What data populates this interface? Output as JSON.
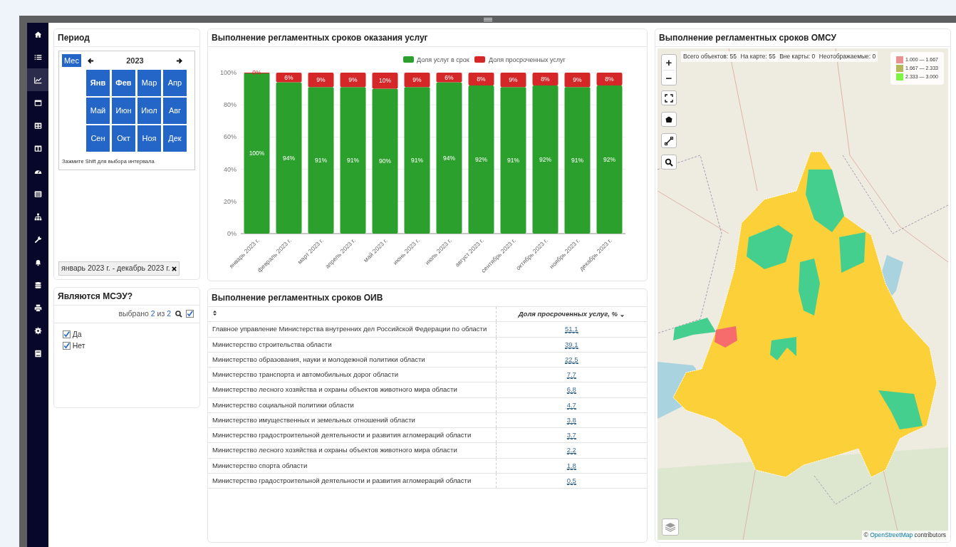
{
  "sidebar": {
    "items": [
      {
        "kind": "home",
        "selected": false
      },
      {
        "kind": "list",
        "selected": false
      },
      {
        "kind": "chart",
        "selected": true
      },
      {
        "kind": "window",
        "selected": false
      },
      {
        "kind": "table",
        "selected": false
      },
      {
        "kind": "columns",
        "selected": false
      },
      {
        "kind": "gauge",
        "selected": false
      },
      {
        "kind": "listbox",
        "selected": false
      },
      {
        "kind": "hierarchy",
        "selected": false
      },
      {
        "kind": "wrench",
        "selected": false
      },
      {
        "kind": "bell",
        "selected": false
      },
      {
        "kind": "database",
        "selected": false
      },
      {
        "kind": "printer",
        "selected": false
      },
      {
        "kind": "gear",
        "selected": false
      },
      {
        "kind": "book",
        "selected": false
      }
    ]
  },
  "period_panel": {
    "title": "Период",
    "mode_button": "Мес",
    "year": "2023",
    "months": [
      {
        "label": "Янв",
        "selected": true,
        "bold": true
      },
      {
        "label": "Фев",
        "selected": true,
        "bold": true
      },
      {
        "label": "Мар",
        "selected": true,
        "bold": false
      },
      {
        "label": "Апр",
        "selected": true,
        "bold": false
      },
      {
        "label": "Май",
        "selected": true,
        "bold": false
      },
      {
        "label": "Июн",
        "selected": true,
        "bold": false
      },
      {
        "label": "Июл",
        "selected": true,
        "bold": false
      },
      {
        "label": "Авг",
        "selected": true,
        "bold": false
      },
      {
        "label": "Сен",
        "selected": true,
        "bold": false
      },
      {
        "label": "Окт",
        "selected": true,
        "bold": false
      },
      {
        "label": "Ноя",
        "selected": true,
        "bold": false
      },
      {
        "label": "Дек",
        "selected": true,
        "bold": false
      }
    ],
    "hint": "Зажмите Shift для выбора интервала",
    "range_chip": "январь 2023 г. - декабрь 2023 г."
  },
  "msu_panel": {
    "title": "Являются МСЭУ?",
    "selection": {
      "prefix": "выбрано",
      "selected_count": "2",
      "separator": "из",
      "total": "2"
    },
    "select_all_checked": true,
    "options": [
      {
        "label": "Да",
        "checked": true
      },
      {
        "label": "Нет",
        "checked": true
      }
    ]
  },
  "chart_panel": {
    "title": "Выполнение регламентных сроков оказания услуг",
    "chart_data": {
      "type": "bar",
      "stacked": true,
      "categories": [
        "январь 2023 г.",
        "февраль 2023 г.",
        "март 2023 г.",
        "апрель 2023 г.",
        "май 2023 г.",
        "июнь 2023 г.",
        "июль 2023 г.",
        "август 2023 г.",
        "сентябрь 2023 г.",
        "октябрь 2023 г.",
        "ноябрь 2023 г.",
        "декабрь 2023 г."
      ],
      "series": [
        {
          "name": "Доля услуг в срок",
          "color": "#2ca02c",
          "values": [
            100,
            94,
            91,
            91,
            90,
            91,
            94,
            92,
            91,
            92,
            91,
            92
          ]
        },
        {
          "name": "Доля просроченных услуг",
          "color": "#d62728",
          "values": [
            0,
            6,
            9,
            9,
            10,
            9,
            6,
            8,
            9,
            8,
            9,
            8
          ]
        }
      ],
      "value_labels": [
        [
          "100%",
          "94%",
          "91%",
          "91%",
          "90%",
          "91%",
          "94%",
          "92%",
          "91%",
          "92%",
          "91%",
          "92%"
        ],
        [
          "0%",
          "6%",
          "9%",
          "9%",
          "10%",
          "9%",
          "6%",
          "8%",
          "9%",
          "8%",
          "9%",
          "8%"
        ]
      ],
      "grid": true,
      "legend": true,
      "ylim": [
        0,
        100
      ],
      "yticks": [
        {
          "value": 0,
          "label": "0%"
        },
        {
          "value": 20,
          "label": "20%"
        },
        {
          "value": 40,
          "label": "40%"
        },
        {
          "value": 60,
          "label": "60%"
        },
        {
          "value": 80,
          "label": "80%"
        },
        {
          "value": 100,
          "label": "100%"
        }
      ]
    }
  },
  "table_panel": {
    "title": "Выполнение регламентных сроков ОИВ",
    "columns": [
      {
        "sorted": false
      },
      {
        "label": "Доля просроченных услуг, %",
        "sorted": true
      }
    ],
    "rows": [
      {
        "name": "Главное управление Министерства внутренних дел Российской Федерации по области",
        "value": "51.1"
      },
      {
        "name": "Министерство строительства области",
        "value": "39.1"
      },
      {
        "name": "Министерство образования, науки и молодежной политики области",
        "value": "22.5"
      },
      {
        "name": "Министерство транспорта и автомобильных дорог области",
        "value": "7.7"
      },
      {
        "name": "Министерство лесного хозяйства и охраны объектов животного мира области",
        "value": "6.8"
      },
      {
        "name": "Министерство социальной политики области",
        "value": "4.7"
      },
      {
        "name": "Министерство имущественных и земельных отношений области",
        "value": "3.8"
      },
      {
        "name": "Министерство градостроительной деятельности и развития агломераций области",
        "value": "3.7"
      },
      {
        "name": "Министерство лесного хозяйства и охраны объектов животного мира области",
        "value": "2.2"
      },
      {
        "name": "Министерство спорта области",
        "value": "1.8"
      },
      {
        "name": "Министерство градостроительной деятельности и развития агломераций области",
        "value": "0.5"
      }
    ]
  },
  "map_panel": {
    "title": "Выполнение регламентных сроков ОМСУ",
    "stats": [
      "Всего объектов: 55",
      "На карте: 55",
      "Вне карты: 0",
      "Неотображаемые: 0"
    ],
    "legend": [
      {
        "label": "1.000 — 1.667",
        "color": "#e99294"
      },
      {
        "label": "1.667 — 2.333",
        "color": "#b6b75a"
      },
      {
        "label": "2.333 — 3.000",
        "color": "#7ef545"
      }
    ],
    "zoom_in": "+",
    "zoom_out": "−",
    "attribution": {
      "prefix": "©",
      "link": "OpenStreetMap",
      "suffix": "contributors"
    }
  }
}
